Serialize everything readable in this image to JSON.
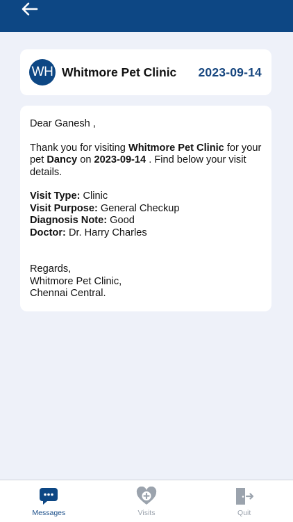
{
  "header": {
    "back_icon": "arrow-left-icon"
  },
  "clinic_card": {
    "avatar_initials": "WH",
    "clinic_name": "Whitmore Pet Clinic",
    "visit_date": "2023-09-14"
  },
  "message": {
    "greeting": "Dear Ganesh ,",
    "intro": {
      "part1": "Thank you for visiting ",
      "clinic": "Whitmore Pet Clinic",
      "part2": " for your pet ",
      "pet": "Dancy",
      "part3": " on ",
      "date": "2023-09-14",
      "part4": " . Find below your visit details."
    },
    "details": [
      {
        "label": "Visit Type:",
        "value": " Clinic"
      },
      {
        "label": "Visit Purpose:",
        "value": " General Checkup"
      },
      {
        "label": "Diagnosis Note:",
        "value": " Good"
      },
      {
        "label": "Doctor:",
        "value": " Dr. Harry Charles"
      }
    ],
    "sign_off": [
      "Regards,",
      "Whitmore Pet Clinic,",
      "Chennai Central."
    ]
  },
  "bottom_nav": [
    {
      "label": "Messages",
      "icon": "chat-bubble-icon",
      "active": true
    },
    {
      "label": "Visits",
      "icon": "heart-plus-icon",
      "active": false
    },
    {
      "label": "Quit",
      "icon": "door-exit-icon",
      "active": false
    }
  ],
  "colors": {
    "primary": "#0d4784",
    "background": "#eef1f9",
    "date_text": "#16467f",
    "inactive_icon": "#9ba3ad"
  }
}
